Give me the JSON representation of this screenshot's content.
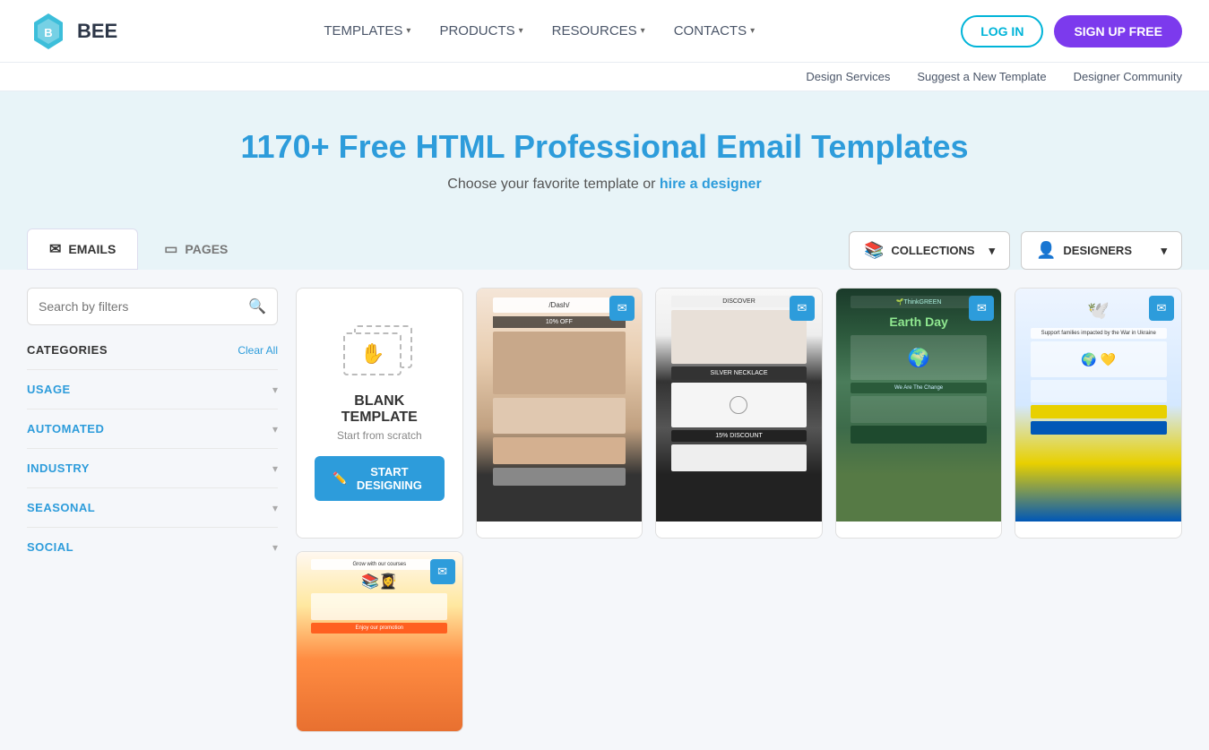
{
  "header": {
    "logo_text": "BEE",
    "nav": [
      {
        "label": "TEMPLATES",
        "has_dropdown": true
      },
      {
        "label": "PRODUCTS",
        "has_dropdown": true
      },
      {
        "label": "RESOURCES",
        "has_dropdown": true
      },
      {
        "label": "CONTACTS",
        "has_dropdown": true
      }
    ],
    "btn_login": "LOG IN",
    "btn_signup": "SIGN UP FREE"
  },
  "sub_nav": [
    {
      "label": "Design Services"
    },
    {
      "label": "Suggest a New Template"
    },
    {
      "label": "Designer Community"
    }
  ],
  "hero": {
    "title": "1170+ Free HTML Professional Email Templates",
    "subtitle_plain": "Choose your favorite template or ",
    "subtitle_link": "hire a designer"
  },
  "tabs": [
    {
      "label": "EMAILS",
      "active": true
    },
    {
      "label": "PAGES",
      "active": false
    }
  ],
  "filter_dropdowns": [
    {
      "icon": "📚",
      "label": "COLLECTIONS"
    },
    {
      "icon": "👤",
      "label": "DESIGNERS"
    }
  ],
  "sidebar": {
    "search_placeholder": "Search by filters",
    "categories_title": "CATEGORIES",
    "clear_all": "Clear All",
    "categories": [
      {
        "label": "USAGE"
      },
      {
        "label": "AUTOMATED"
      },
      {
        "label": "INDUSTRY"
      },
      {
        "label": "SEASONAL"
      },
      {
        "label": "SOCIAL"
      }
    ]
  },
  "templates": {
    "blank": {
      "title": "BLANK",
      "title2": "TEMPLATE",
      "subtitle": "Start from scratch",
      "btn_label": "START DESIGNING"
    },
    "cards": [
      {
        "theme": "tpl-fashion",
        "has_badge": true
      },
      {
        "theme": "tpl-jewelry",
        "has_badge": true
      },
      {
        "theme": "tpl-earth",
        "has_badge": true
      },
      {
        "theme": "tpl-ukraine",
        "has_badge": true
      },
      {
        "theme": "tpl-education",
        "has_badge": true
      },
      {
        "theme": "tpl-beauty",
        "has_badge": true
      }
    ]
  }
}
